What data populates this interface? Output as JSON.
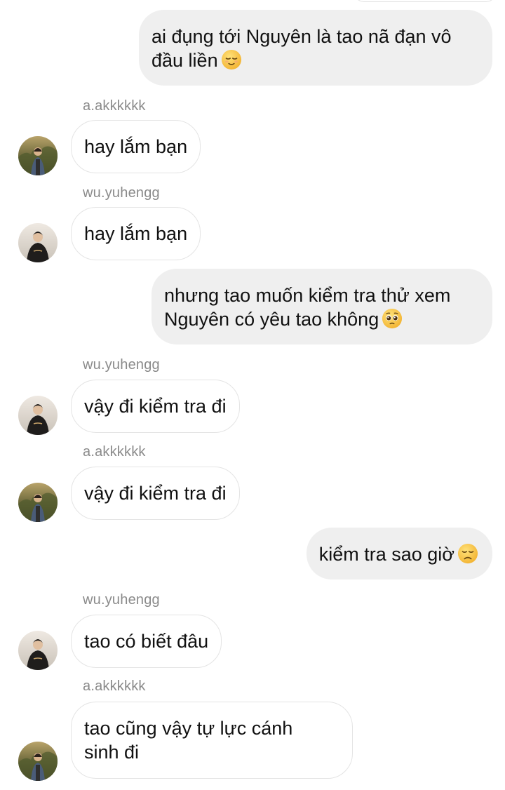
{
  "messages": [
    {
      "id": "m1",
      "direction": "out",
      "text": "ai đụng tới Nguyên là tao nã đạn vô\nđầu liền",
      "emoji": "relieved-face-icon"
    },
    {
      "id": "m2",
      "direction": "in",
      "sender": "a.akkkkkk",
      "text": "hay lắm bạn",
      "avatar": "avatar-a-akkkkkk"
    },
    {
      "id": "m3",
      "direction": "in",
      "sender": "wu.yuhengg",
      "text": "hay lắm bạn",
      "avatar": "avatar-wu-yuhengg"
    },
    {
      "id": "m4",
      "direction": "out",
      "text": "nhưng tao muốn kiểm tra thử xem\nNguyên có yêu tao không",
      "emoji": "pleading-face-icon"
    },
    {
      "id": "m5",
      "direction": "in",
      "sender": "wu.yuhengg",
      "text": "vậy đi kiểm tra đi",
      "avatar": "avatar-wu-yuhengg"
    },
    {
      "id": "m6",
      "direction": "in",
      "sender": "a.akkkkkk",
      "text": "vậy đi kiểm tra đi",
      "avatar": "avatar-a-akkkkkk"
    },
    {
      "id": "m7",
      "direction": "out",
      "text": "kiểm tra sao giờ",
      "emoji": "disappointed-face-icon"
    },
    {
      "id": "m8",
      "direction": "in",
      "sender": "wu.yuhengg",
      "text": "tao có biết đâu",
      "avatar": "avatar-wu-yuhengg"
    },
    {
      "id": "m9",
      "direction": "in",
      "sender": "a.akkkkkk",
      "text": "tao cũng vậy tự lực cánh\nsinh đi",
      "avatar": "avatar-a-akkkkkk"
    }
  ],
  "colors": {
    "outgoing_bubble": "#efefef",
    "incoming_bubble": "#ffffff",
    "incoming_border": "#e4e4e4",
    "sender_name": "#8a8a8a",
    "text": "#111111",
    "emoji_yellow": "#f6c244"
  }
}
